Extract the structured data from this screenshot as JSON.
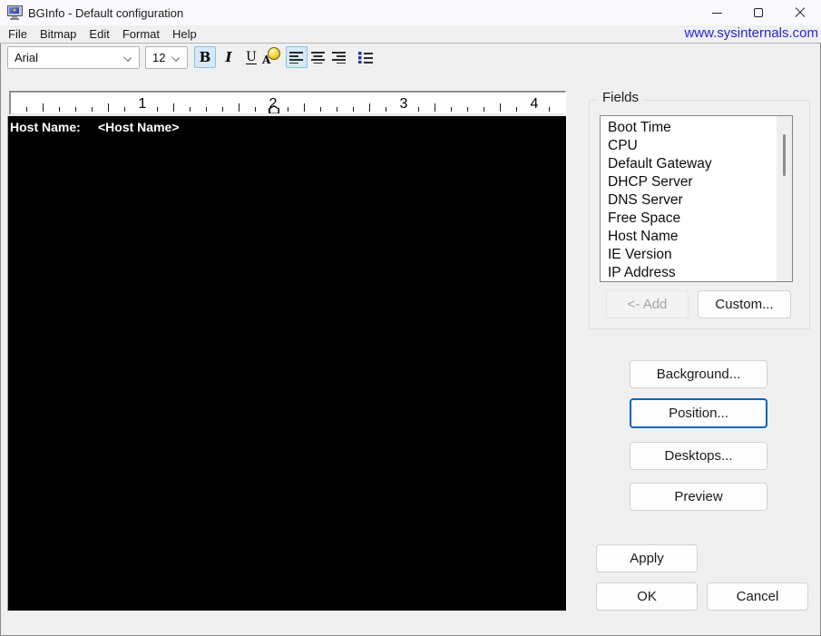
{
  "window": {
    "title": "BGInfo - Default configuration",
    "link": "www.sysinternals.com"
  },
  "menu": {
    "items": [
      "File",
      "Bitmap",
      "Edit",
      "Format",
      "Help"
    ]
  },
  "toolbar": {
    "font_value": "Arial",
    "size_value": "12",
    "bold_label": "B",
    "italic_label": "I",
    "underline_label": "U",
    "fontcolor_label": "A"
  },
  "ruler": {
    "numbers": [
      "1",
      "2",
      "3",
      "4"
    ]
  },
  "preview": {
    "label": "Host Name:",
    "value": "<Host Name>"
  },
  "fields": {
    "title": "Fields",
    "items": [
      "Boot Time",
      "CPU",
      "Default Gateway",
      "DHCP Server",
      "DNS Server",
      "Free Space",
      "Host Name",
      "IE Version",
      "IP Address"
    ],
    "add_label": "<- Add",
    "custom_label": "Custom..."
  },
  "actions": {
    "background": "Background...",
    "position": "Position...",
    "desktops": "Desktops...",
    "preview": "Preview",
    "apply": "Apply",
    "ok": "OK",
    "cancel": "Cancel"
  },
  "colors": {
    "accent_focus": "#0067c0",
    "link_blue": "#2424dd",
    "toolbar_active_bg": "#d6e9f8",
    "preview_bg": "#000000",
    "window_bg": "#f0f0f0"
  }
}
